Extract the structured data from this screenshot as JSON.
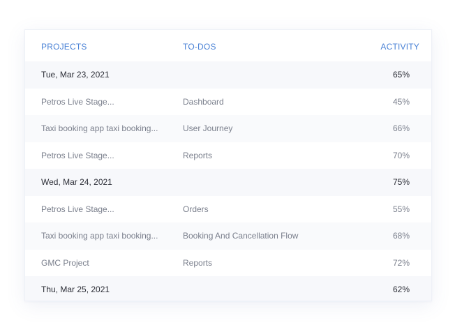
{
  "table": {
    "headers": {
      "projects": "PROJECTS",
      "todos": "TO-DOS",
      "activity": "ACTIVITY"
    },
    "rows": [
      {
        "type": "date",
        "project": "Tue, Mar 23, 2021",
        "todo": "",
        "activity": "65%"
      },
      {
        "type": "entry",
        "project": "Petros Live Stage...",
        "todo": "Dashboard",
        "activity": "45%"
      },
      {
        "type": "entry",
        "project": "Taxi booking app taxi booking...",
        "todo": "User Journey",
        "activity": "66%"
      },
      {
        "type": "entry",
        "project": "Petros Live Stage...",
        "todo": "Reports",
        "activity": "70%"
      },
      {
        "type": "date",
        "project": "Wed, Mar 24, 2021",
        "todo": "",
        "activity": "75%"
      },
      {
        "type": "entry",
        "project": "Petros Live Stage...",
        "todo": "Orders",
        "activity": "55%"
      },
      {
        "type": "entry",
        "project": "Taxi booking app taxi booking...",
        "todo": "Booking And Cancellation Flow",
        "activity": "68%"
      },
      {
        "type": "entry",
        "project": "GMC Project",
        "todo": "Reports",
        "activity": "72%"
      },
      {
        "type": "date",
        "project": "Thu, Mar 25, 2021",
        "todo": "",
        "activity": "62%"
      }
    ]
  },
  "colors": {
    "header_text": "#4a82d6",
    "date_row_bg": "#f7f8fb",
    "date_text": "#2b2d36",
    "entry_text": "#7a7f8c"
  }
}
